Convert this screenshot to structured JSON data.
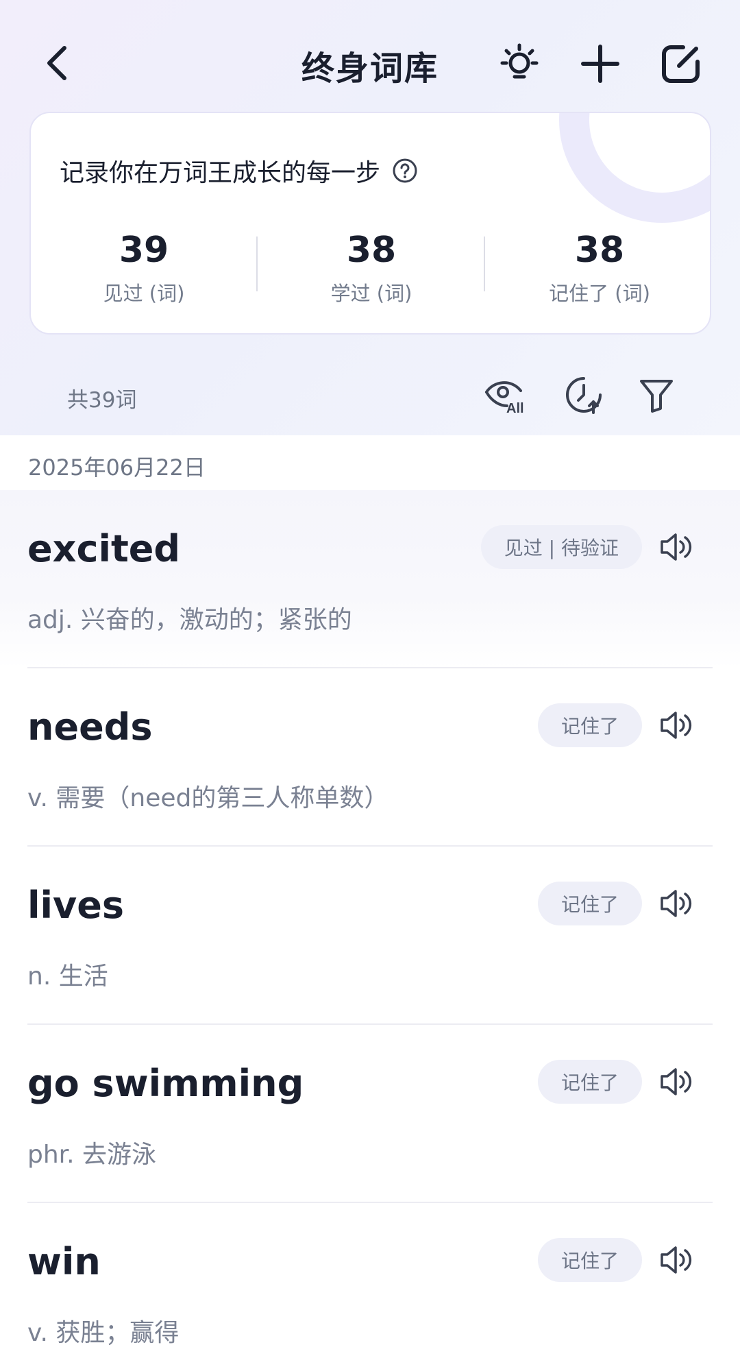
{
  "header": {
    "title": "终身词库",
    "icons": [
      "back-icon",
      "bulb-icon",
      "plus-icon",
      "edit-icon"
    ]
  },
  "stats_card": {
    "headline": "记录你在万词王成长的每一步",
    "stats": [
      {
        "value": "39",
        "label": "见过 (词)"
      },
      {
        "value": "38",
        "label": "学过 (词)"
      },
      {
        "value": "38",
        "label": "记住了 (词)"
      }
    ]
  },
  "toolbar": {
    "word_count": "共39词",
    "eye_badge": "All"
  },
  "date": "2025年06月22日",
  "words": [
    {
      "term": "excited",
      "definition": "adj. 兴奋的，激动的；紧张的",
      "status": "见过 | 待验证"
    },
    {
      "term": "needs",
      "definition": "v. 需要（need的第三人称单数）",
      "status": "记住了"
    },
    {
      "term": "lives",
      "definition": "n. 生活",
      "status": "记住了"
    },
    {
      "term": "go swimming",
      "definition": "phr. 去游泳",
      "status": "记住了"
    },
    {
      "term": "win",
      "definition": "v. 获胜；赢得",
      "status": "记住了"
    }
  ],
  "colors": {
    "text_primary": "#1a1f2e",
    "text_secondary": "#7a8192",
    "badge_bg": "#eeeff8",
    "header_bg": "#f2eefb"
  }
}
